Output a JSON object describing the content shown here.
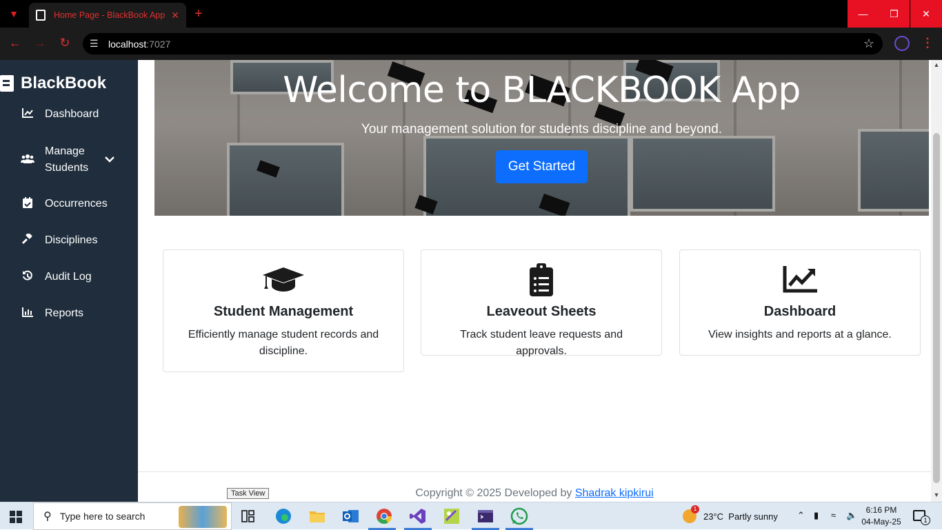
{
  "browser": {
    "tab_title": "Home Page - BlackBook App",
    "url_host": "localhost",
    "url_port": ":7027"
  },
  "sidebar": {
    "brand": "BlackBook",
    "items": [
      {
        "label": "Dashboard",
        "icon": "chart-line-icon"
      },
      {
        "label": "Manage Students",
        "icon": "users-icon"
      },
      {
        "label": "Occurrences",
        "icon": "calendar-check-icon"
      },
      {
        "label": "Disciplines",
        "icon": "gavel-icon"
      },
      {
        "label": "Audit Log",
        "icon": "history-icon"
      },
      {
        "label": "Reports",
        "icon": "bar-chart-icon"
      }
    ]
  },
  "hero": {
    "title": "Welcome to BLACKBOOK App",
    "subtitle": "Your management solution for students discipline and beyond.",
    "cta_label": "Get Started"
  },
  "cards": [
    {
      "title": "Student Management",
      "description": "Efficiently manage student records and discipline.",
      "icon": "graduation-cap-icon"
    },
    {
      "title": "Leaveout Sheets",
      "description": "Track student leave requests and approvals.",
      "icon": "clipboard-list-icon"
    },
    {
      "title": "Dashboard",
      "description": "View insights and reports at a glance.",
      "icon": "chart-trend-icon"
    }
  ],
  "footer": {
    "text": "Copyright © 2025 Developed by",
    "author": "Shadrak kipkirui"
  },
  "tooltip": "Task View",
  "taskbar": {
    "search_placeholder": "Type here to search",
    "weather_temp": "23°C",
    "weather_desc": "Partly sunny",
    "weather_badge": "1",
    "time": "6:16 PM",
    "date": "04-May-25",
    "notif_count": "1"
  },
  "colors": {
    "sidebar_bg": "#1f2d3c",
    "primary": "#0d6efd",
    "browser_accent": "#e03030"
  }
}
